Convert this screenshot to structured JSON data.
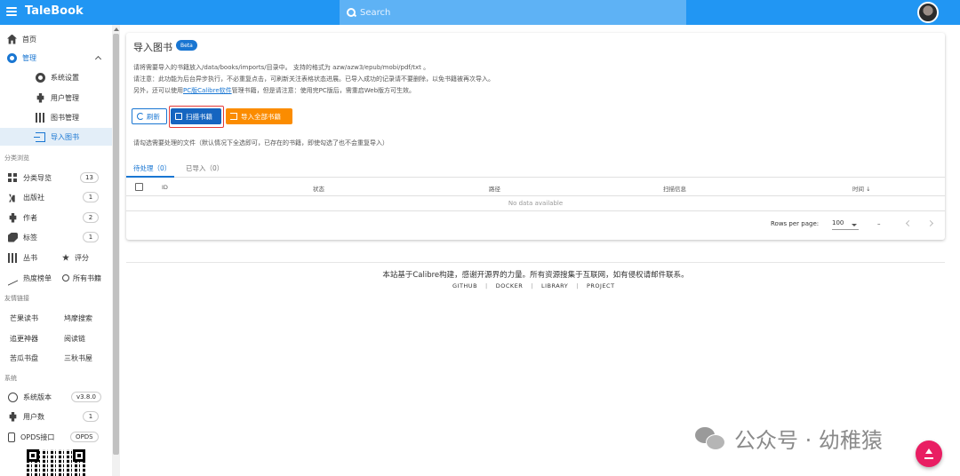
{
  "app": {
    "title": "TaleBook"
  },
  "search": {
    "placeholder": "Search"
  },
  "sidebar": {
    "home": "首页",
    "manage": "管理",
    "manage_children": [
      "系统设置",
      "用户管理",
      "图书管理",
      "导入图书"
    ],
    "sections": {
      "browse": "分类浏览",
      "links": "友情链接",
      "system": "系统"
    },
    "browse": [
      {
        "label": "分类导览",
        "count": "13"
      },
      {
        "label": "出版社",
        "count": "1"
      },
      {
        "label": "作者",
        "count": "2"
      },
      {
        "label": "标签",
        "count": "1"
      }
    ],
    "pairs": [
      {
        "left": "丛书",
        "right": "评分"
      },
      {
        "left": "热度榜单",
        "right": "所有书籍"
      }
    ],
    "links": [
      [
        "芒果读书",
        "鸠摩搜索"
      ],
      [
        "追更神器",
        "阅读链"
      ],
      [
        "苦瓜书盘",
        "三秋书屋"
      ]
    ],
    "system": [
      {
        "label": "系统版本",
        "value": "v3.8.0"
      },
      {
        "label": "用户数",
        "value": "1"
      },
      {
        "label": "OPDS接口",
        "value": "OPDS"
      }
    ]
  },
  "main": {
    "title": "导入图书",
    "badge": "Beta",
    "desc1": "请将需要导入的书籍放入/data/books/imports/目录中。 支持的格式为 azw/azw3/epub/mobi/pdf/txt 。",
    "desc2": "请注意：此功能为后台异步执行，不必重复点击，可刷新关注表格状态进展。已导入成功的记录请不要删除，以免书籍被再次导入。",
    "desc3_pre": "另外，还可以使用",
    "desc3_link": "PC版Calibre软件",
    "desc3_post": "管理书籍，但是请注意：使用完PC版后，需重启Web版方可生效。",
    "buttons": {
      "refresh": "刷新",
      "scan": "扫描书籍",
      "import_all": "导入全部书籍"
    },
    "hint": "请勾选需要处理的文件（默认情况下全选即可，已存在的书籍，即使勾选了也不会重复导入）",
    "tabs": [
      "待处理（0）",
      "已导入（0）"
    ],
    "table": {
      "headers": [
        "ID",
        "状态",
        "路径",
        "扫描信息",
        "时间 ↓"
      ],
      "empty": "No data available"
    },
    "pager": {
      "rows_label": "Rows per page:",
      "rows_value": "100",
      "range": "–"
    }
  },
  "footer": {
    "text": "本站基于Calibre构建，感谢开源界的力量。所有资源搜集于互联网，如有侵权请邮件联系。",
    "links": [
      "GITHUB",
      "DOCKER",
      "LIBRARY",
      "PROJECT"
    ]
  },
  "watermark": {
    "text": "公众号 · 幼稚猿"
  }
}
